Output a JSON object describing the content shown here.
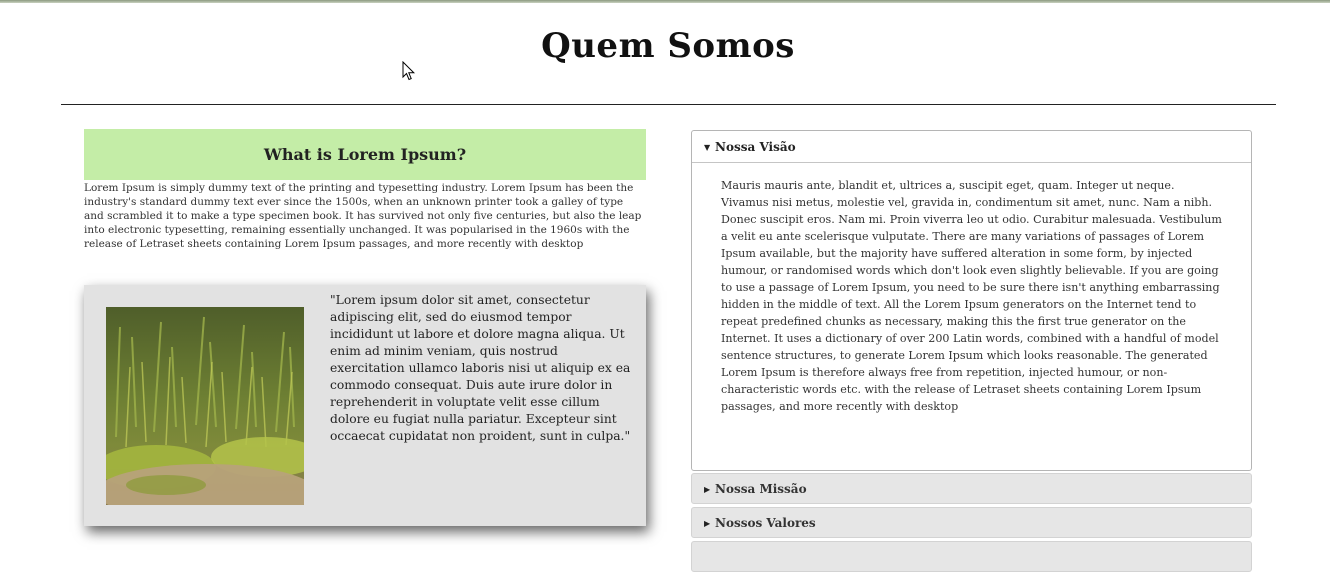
{
  "page": {
    "title": "Quem Somos"
  },
  "section": {
    "heading": "What is Lorem Ipsum?",
    "body": "Lorem Ipsum is simply dummy text of the printing and typesetting industry. Lorem Ipsum has been the industry's standard dummy text ever since the 1500s, when an unknown printer took a galley of type and scrambled it to make a type specimen book. It has survived not only five centuries, but also the leap into electronic typesetting, remaining essentially unchanged. It was popularised in the 1960s with the release of Letraset sheets containing Lorem Ipsum passages, and more recently with desktop"
  },
  "card": {
    "quote": "\"Lorem ipsum dolor sit amet, consectetur adipiscing elit, sed do eiusmod tempor incididunt ut labore et dolore magna aliqua. Ut enim ad minim veniam, quis nostrud exercitation ullamco laboris nisi ut aliquip ex ea commodo consequat. Duis aute irure dolor in reprehenderit in voluptate velit esse cillum dolore eu fugiat nulla pariatur. Excepteur sint occaecat cupidatat non proident, sunt in culpa.\""
  },
  "accordion": {
    "items": [
      {
        "title": "Nossa Visão",
        "expanded": true,
        "body": "Mauris mauris ante, blandit et, ultrices a, suscipit eget, quam. Integer ut neque. Vivamus nisi metus, molestie vel, gravida in, condimentum sit amet, nunc. Nam a nibh. Donec suscipit eros. Nam mi. Proin viverra leo ut odio. Curabitur malesuada. Vestibulum a velit eu ante scelerisque vulputate. There are many variations of passages of Lorem Ipsum available, but the majority have suffered alteration in some form, by injected humour, or randomised words which don't look even slightly believable. If you are going to use a passage of Lorem Ipsum, you need to be sure there isn't anything embarrassing hidden in the middle of text. All the Lorem Ipsum generators on the Internet tend to repeat predefined chunks as necessary, making this the first true generator on the Internet. It uses a dictionary of over 200 Latin words, combined with a handful of model sentence structures, to generate Lorem Ipsum which looks reasonable. The generated Lorem Ipsum is therefore always free from repetition, injected humour, or non-characteristic words etc. with the release of Letraset sheets containing Lorem Ipsum passages, and more recently with desktop"
      },
      {
        "title": "Nossa Missão",
        "expanded": false
      },
      {
        "title": "Nossos Valores",
        "expanded": false
      },
      {
        "title": "",
        "expanded": false
      }
    ]
  },
  "colors": {
    "header_bg": "#c4eda7",
    "card_bg": "#e2e2e2",
    "accordion_closed_bg": "#e6e6e6"
  },
  "icons": {
    "expanded": "caret-down-icon",
    "collapsed": "caret-right-icon"
  }
}
